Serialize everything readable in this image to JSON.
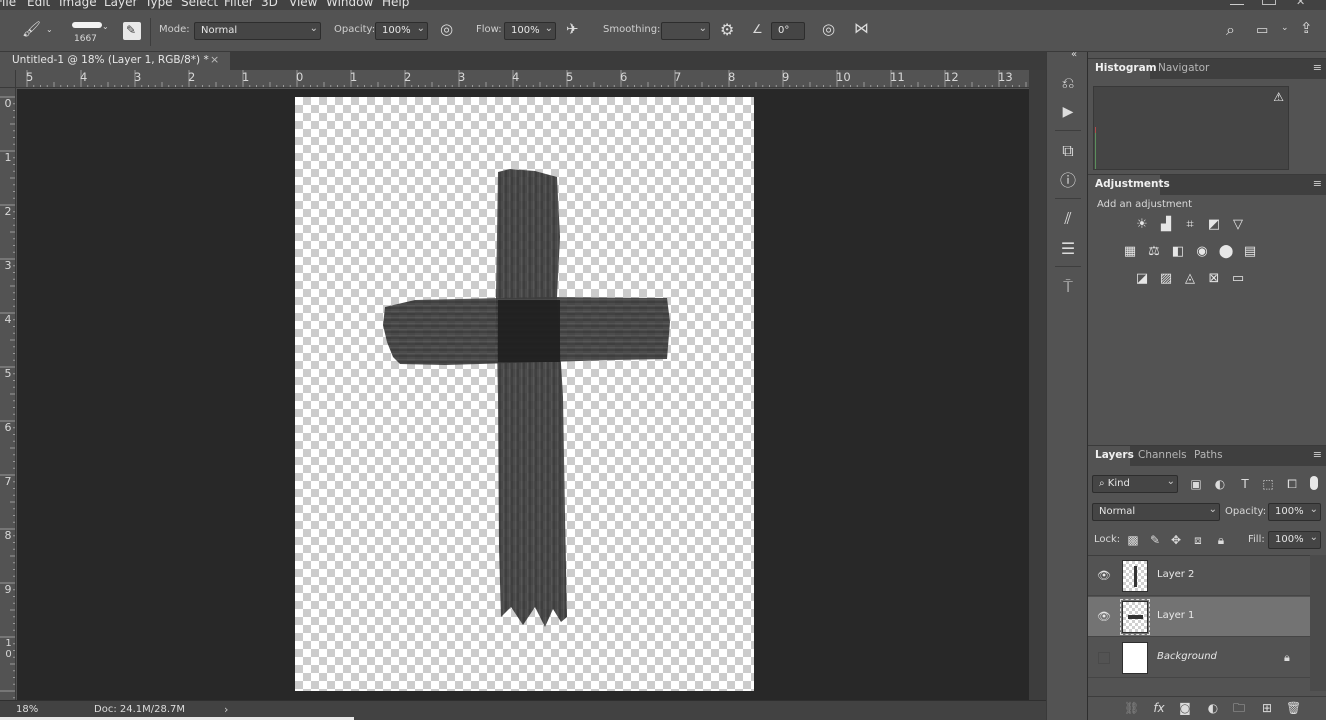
{
  "menubar": {
    "items": [
      "File",
      "Edit",
      "Image",
      "Layer",
      "Type",
      "Select",
      "Filter",
      "3D",
      "View",
      "Window",
      "Help"
    ]
  },
  "options": {
    "brush_size": "1667",
    "mode_label": "Mode:",
    "mode_value": "Normal",
    "opacity_label": "Opacity:",
    "opacity_value": "100%",
    "flow_label": "Flow:",
    "flow_value": "100%",
    "smoothing_label": "Smoothing:",
    "smoothing_value": "",
    "angle_value": "0°"
  },
  "document": {
    "tab_title": "Untitled-1 @ 18% (Layer 1, RGB/8*) *",
    "close_glyph": "×"
  },
  "rulers": {
    "top": [
      "5",
      "4",
      "3",
      "2",
      "1",
      "0",
      "1",
      "2",
      "3",
      "4",
      "5",
      "6",
      "7",
      "8",
      "9",
      "10",
      "11",
      "12",
      "13"
    ],
    "left": [
      "0",
      "1",
      "2",
      "3",
      "4",
      "5",
      "6",
      "7",
      "8",
      "9",
      "10"
    ]
  },
  "status": {
    "zoom": "18%",
    "doc_size": "Doc: 24.1M/28.7M",
    "arrow": "›"
  },
  "panels": {
    "histogram": {
      "tab1": "Histogram",
      "tab2": "Navigator",
      "warning": "⚠"
    },
    "adjustments": {
      "tab": "Adjustments",
      "subtitle": "Add an adjustment"
    },
    "layers": {
      "tab1": "Layers",
      "tab2": "Channels",
      "tab3": "Paths",
      "filter_kind": "Kind",
      "blend_mode": "Normal",
      "opacity_label": "Opacity:",
      "opacity_value": "100%",
      "lock_label": "Lock:",
      "fill_label": "Fill:",
      "fill_value": "100%",
      "rows": [
        {
          "name": "Layer 2",
          "visible": true,
          "selected": false
        },
        {
          "name": "Layer 1",
          "visible": true,
          "selected": true
        },
        {
          "name": "Background",
          "visible": false,
          "selected": false,
          "locked": true
        }
      ]
    }
  },
  "colors": {
    "ui_bg": "#535353",
    "pasteboard": "#282828",
    "selection": "#737373",
    "brush_stroke": "#3b3b3b"
  }
}
